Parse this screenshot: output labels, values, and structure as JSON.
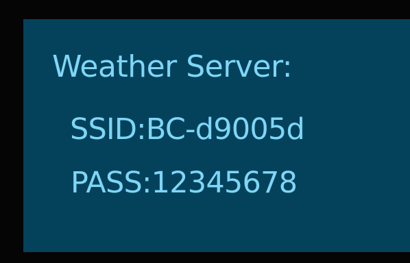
{
  "screen": {
    "title": "Weather Server:",
    "ssid": "SSID:BC-d9005d",
    "pass": "PASS:12345678"
  },
  "colors": {
    "border": "#050505",
    "background": "#04425c",
    "text": "#7fd6f6"
  }
}
